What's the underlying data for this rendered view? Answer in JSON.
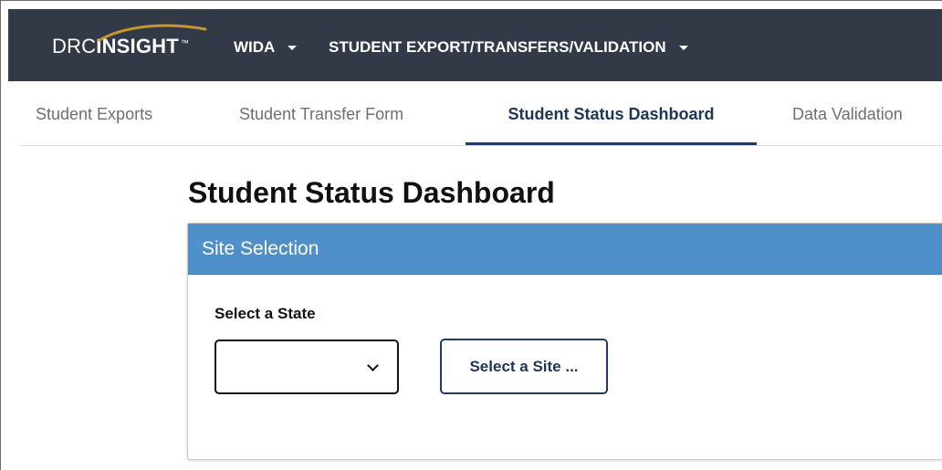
{
  "header": {
    "logo": {
      "text_left": "DRC",
      "text_right": "INSIGHT",
      "trademark": "™"
    },
    "menus": [
      {
        "label": "WIDA"
      },
      {
        "label": "STUDENT EXPORT/TRANSFERS/VALIDATION"
      }
    ]
  },
  "tabs": [
    {
      "label": "Student Exports",
      "active": false
    },
    {
      "label": "Student Transfer Form",
      "active": false
    },
    {
      "label": "Student Status Dashboard",
      "active": true
    },
    {
      "label": "Data Validation",
      "active": false
    }
  ],
  "page": {
    "title": "Student Status Dashboard"
  },
  "panel": {
    "header": "Site Selection",
    "state_label": "Select a State",
    "state_value": "",
    "site_button_label": "Select a Site ..."
  },
  "colors": {
    "topbar": "#323a48",
    "panel_header": "#4f8fca",
    "accent": "#1f3d63",
    "logo_swoosh": "#c8972b"
  }
}
